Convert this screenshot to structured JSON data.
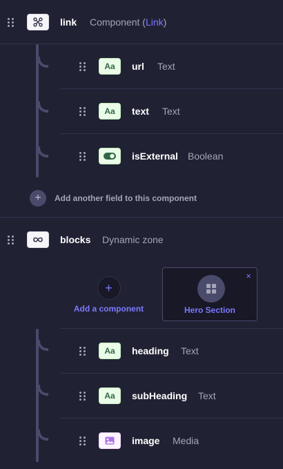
{
  "link_field": {
    "name": "link",
    "type_prefix": "Component (",
    "type_link": "Link",
    "type_suffix": ")",
    "icon": "component-icon"
  },
  "link_children": [
    {
      "name": "url",
      "type": "Text",
      "icon": "text-icon",
      "icon_text": "Aa"
    },
    {
      "name": "text",
      "type": "Text",
      "icon": "text-icon",
      "icon_text": "Aa"
    },
    {
      "name": "isExternal",
      "type": "Boolean",
      "icon": "toggle-icon"
    }
  ],
  "add_field": {
    "plus": "+",
    "label": "Add another field to this component"
  },
  "blocks_field": {
    "name": "blocks",
    "type": "Dynamic zone",
    "icon": "infinity-icon"
  },
  "add_component": {
    "plus": "+",
    "label": "Add a component"
  },
  "hero_card": {
    "label": "Hero Section",
    "close": "×",
    "icon": "grid-icon"
  },
  "hero_children": [
    {
      "name": "heading",
      "type": "Text",
      "icon": "text-icon",
      "icon_text": "Aa"
    },
    {
      "name": "subHeading",
      "type": "Text",
      "icon": "text-icon",
      "icon_text": "Aa"
    },
    {
      "name": "image",
      "type": "Media",
      "icon": "media-icon"
    }
  ],
  "colors": {
    "background": "#212134",
    "accent": "#7b79ff",
    "muted": "#a5a5ba",
    "green": "#2f6846"
  }
}
